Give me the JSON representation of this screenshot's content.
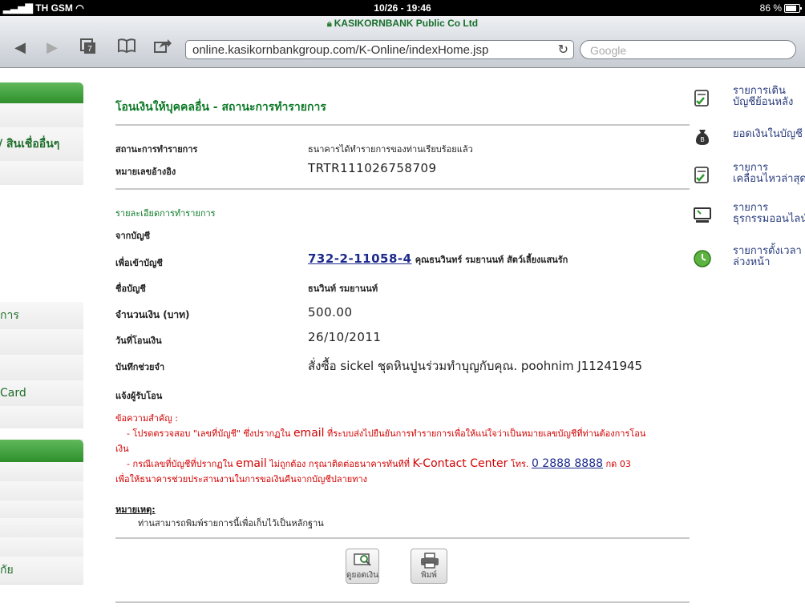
{
  "status_bar": {
    "carrier": "TH GSM",
    "time": "10/26 - 19:46",
    "battery": "86 %"
  },
  "browser": {
    "site_title": "KASIKORNBANK Public Co Ltd",
    "url": "online.kasikornbankgroup.com/K-Online/indexHome.jsp",
    "search_placeholder": "Google",
    "tab_count": "7"
  },
  "left_nav": {
    "items": [
      "/ สินเชื่ออื่นๆ",
      "การ",
      "Card",
      "กัย"
    ]
  },
  "main": {
    "title": "โอนเงินให้บุคคลอื่น - สถานะการทำรายการ",
    "status_label": "สถานะการทำรายการ",
    "status_value": "ธนาคารได้ทำรายการของท่านเรียบร้อยแล้ว",
    "ref_label": "หมายเลขอ้างอิง",
    "ref_value": "TRTR111026758709",
    "details_title": "รายละเอียดการทำรายการ",
    "from_label": "จากบัญชี",
    "to_label": "เพื่อเข้าบัญชี",
    "to_account": "732-2-11058-4",
    "to_account_desc": "คุณธนวินทร์ รมยานนท์ สัตว์เลี้ยงแสนรัก",
    "name_label": "ชื่อบัญชี",
    "name_value": "ธนวินท์ รมยานนท์",
    "amount_label": "จำนวนเงิน (บาท)",
    "amount_value": "500.00",
    "date_label": "วันที่โอนเงิน",
    "date_value": "26/10/2011",
    "memo_label": "บันทึกช่วยจำ",
    "memo_value": "สั่งซื้อ sickel ชุดหินปูนร่วมทำบุญกับคุณ. poohnim J11241945",
    "notify_label": "แจ้งผู้รับโอน",
    "warning_title": "ข้อความสำคัญ :",
    "warning_1a": "- โปรดตรวจสอบ \"เลขที่บัญชี\" ซึ่งปรากฏใน",
    "warning_1_email": "email",
    "warning_1b": "ที่ระบบส่งไปยืนยันการทำรายการเพื่อให้แน่ใจว่าเป็นหมายเลขบัญชีที่ท่านต้องการโอน",
    "warning_1c": "เงิน",
    "warning_2a": "- กรณีเลขที่บัญชีที่ปรากฏใน",
    "warning_2_email": "email",
    "warning_2b": "ไม่ถูกต้อง กรุณาติดต่อธนาคารทันทีที่",
    "warning_2_center": "K-Contact Center",
    "warning_2_tel": "โทร.",
    "warning_2_phone": "0 2888 8888",
    "warning_2_ext": "กด 03",
    "warning_2c": "เพื่อให้ธนาคารช่วยประสานงานในการขอเงินคืนจากบัญชีปลายทาง",
    "note_title": "หมายเหตุ:",
    "note_text": "ท่านสามารถพิมพ์รายการนี้เพื่อเก็บไว้เป็นหลักฐาน",
    "btn_view_balance": "ดูยอดเงิน",
    "btn_print": "พิมพ์"
  },
  "right_panel": {
    "items": [
      {
        "line1": "รายการเดิน",
        "line2": "บัญชีย้อนหลัง",
        "icon": "document-check-icon"
      },
      {
        "line1": "ยอดเงินในบัญชี",
        "line2": "",
        "icon": "money-bag-icon"
      },
      {
        "line1": "รายการ",
        "line2": "เคลื่อนไหวล่าสุด",
        "icon": "document-check-icon"
      },
      {
        "line1": "รายการ",
        "line2": "ธุรกรรมออนไลน์",
        "icon": "computer-icon"
      },
      {
        "line1": "รายการตั้งเวลา",
        "line2": "ล่วงหน้า",
        "icon": "clock-icon"
      }
    ]
  },
  "colors": {
    "brand_green": "#0d7a28",
    "warning_red": "#d40000",
    "link_blue": "#1c2a8c"
  }
}
